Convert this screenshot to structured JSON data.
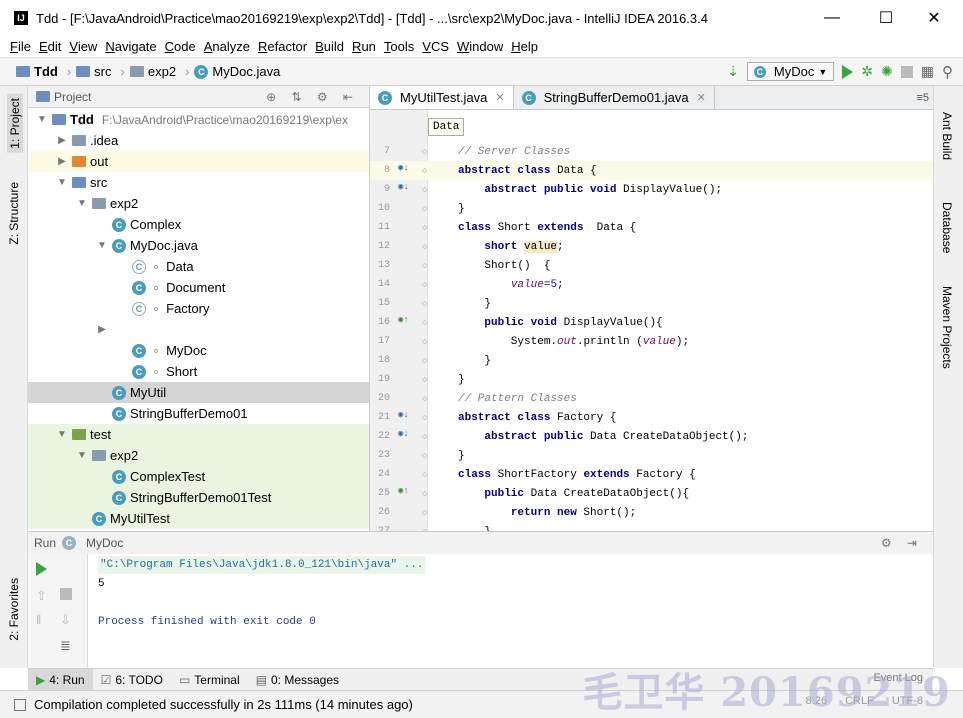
{
  "window": {
    "title": "Tdd - [F:\\JavaAndroid\\Practice\\mao20169219\\exp\\exp2\\Tdd] - [Tdd] - ...\\src\\exp2\\MyDoc.java - IntelliJ IDEA 2016.3.4",
    "app_icon": "IJ",
    "minimize": "—",
    "maximize": "☐",
    "close": "✕"
  },
  "menu": [
    "File",
    "Edit",
    "View",
    "Navigate",
    "Code",
    "Analyze",
    "Refactor",
    "Build",
    "Run",
    "Tools",
    "VCS",
    "Window",
    "Help"
  ],
  "breadcrumbs": [
    "Tdd",
    "src",
    "exp2",
    "MyDoc.java"
  ],
  "run_config": "MyDoc",
  "left_tabs": [
    "1: Project",
    "Z: Structure",
    "2: Favorites"
  ],
  "right_tabs": [
    "Ant Build",
    "Database",
    "Maven Projects"
  ],
  "project_panel": {
    "title": "Project",
    "tree": [
      {
        "label": "Tdd",
        "path": "F:\\JavaAndroid\\Practice\\mao20169219\\exp\\ex",
        "depth": 0,
        "arrow": "▼",
        "icon": "module",
        "state": ""
      },
      {
        "label": ".idea",
        "depth": 1,
        "arrow": "▶",
        "icon": "folder",
        "state": ""
      },
      {
        "label": "out",
        "depth": 1,
        "arrow": "▶",
        "icon": "folder-orange",
        "state": "yellow"
      },
      {
        "label": "src",
        "depth": 1,
        "arrow": "▼",
        "icon": "folder-blue",
        "state": ""
      },
      {
        "label": "exp2",
        "depth": 2,
        "arrow": "▼",
        "icon": "package",
        "state": ""
      },
      {
        "label": "Complex",
        "depth": 3,
        "arrow": "",
        "icon": "class",
        "state": ""
      },
      {
        "label": "MyDoc.java",
        "depth": 3,
        "arrow": "▼",
        "icon": "class",
        "state": ""
      },
      {
        "label": "Data",
        "depth": 4,
        "arrow": "",
        "icon": "class-abstract",
        "state": ""
      },
      {
        "label": "Document",
        "depth": 4,
        "arrow": "",
        "icon": "class",
        "state": ""
      },
      {
        "label": "Factory",
        "depth": 4,
        "arrow": "",
        "icon": "class-abstract",
        "state": ""
      },
      {
        "label": "",
        "depth": 3,
        "arrow": "▶",
        "icon": "",
        "state": ""
      },
      {
        "label": "MyDoc",
        "depth": 4,
        "arrow": "",
        "icon": "class-run",
        "state": ""
      },
      {
        "label": "Short",
        "depth": 4,
        "arrow": "",
        "icon": "class",
        "state": ""
      },
      {
        "label": "MyUtil",
        "depth": 3,
        "arrow": "",
        "icon": "class",
        "state": "sel"
      },
      {
        "label": "StringBufferDemo01",
        "depth": 3,
        "arrow": "",
        "icon": "class-run",
        "state": ""
      },
      {
        "label": "test",
        "depth": 1,
        "arrow": "▼",
        "icon": "folder-green",
        "state": "green"
      },
      {
        "label": "exp2",
        "depth": 2,
        "arrow": "▼",
        "icon": "package",
        "state": "green"
      },
      {
        "label": "ComplexTest",
        "depth": 3,
        "arrow": "",
        "icon": "class-run",
        "state": "green"
      },
      {
        "label": "StringBufferDemo01Test",
        "depth": 3,
        "arrow": "",
        "icon": "class-run",
        "state": "green"
      },
      {
        "label": "MyUtilTest",
        "depth": 2,
        "arrow": "",
        "icon": "class-run",
        "state": "green"
      }
    ]
  },
  "editor_tabs": [
    {
      "label": "MyUtilTest.java",
      "active": true
    },
    {
      "label": "StringBufferDemo01.java",
      "active": false
    }
  ],
  "editor_tab_count": "5",
  "crumb_tip": "Data",
  "code": [
    {
      "n": "7",
      "html": "<span class='cm'>// Server Classes</span>",
      "mark": ""
    },
    {
      "n": "8",
      "html": "<span class='kw'>abstract class</span> Data {",
      "mark": "impl",
      "cur": true
    },
    {
      "n": "9",
      "html": "    <span class='kw'>abstract public void</span> DisplayValue();",
      "mark": "impl"
    },
    {
      "n": "10",
      "html": "}",
      "mark": ""
    },
    {
      "n": "11",
      "html": "<span class='kw'>class</span> Short <span class='kw'>extends</span>  Data {",
      "mark": ""
    },
    {
      "n": "12",
      "html": "    <span class='kw'>short</span> <span class='vhl'>value</span>;",
      "mark": ""
    },
    {
      "n": "13",
      "html": "    Short()  {",
      "mark": ""
    },
    {
      "n": "14",
      "html": "        <span class='fld'>value</span>=<span class='num'>5</span>;",
      "mark": ""
    },
    {
      "n": "15",
      "html": "    }",
      "mark": ""
    },
    {
      "n": "16",
      "html": "    <span class='kw'>public void</span> DisplayValue(){",
      "mark": "over"
    },
    {
      "n": "17",
      "html": "        System.<span class='fld'>out</span>.println (<span class='fld'>value</span>);",
      "mark": ""
    },
    {
      "n": "18",
      "html": "    }",
      "mark": ""
    },
    {
      "n": "19",
      "html": "}",
      "mark": ""
    },
    {
      "n": "20",
      "html": "<span class='cm'>// Pattern Classes</span>",
      "mark": ""
    },
    {
      "n": "21",
      "html": "<span class='kw'>abstract class</span> Factory {",
      "mark": "impl"
    },
    {
      "n": "22",
      "html": "    <span class='kw'>abstract public</span> Data CreateDataObject();",
      "mark": "impl"
    },
    {
      "n": "23",
      "html": "}",
      "mark": ""
    },
    {
      "n": "24",
      "html": "<span class='kw'>class</span> ShortFactory <span class='kw'>extends</span> Factory {",
      "mark": ""
    },
    {
      "n": "25",
      "html": "    <span class='kw'>public</span> Data CreateDataObject(){",
      "mark": "over"
    },
    {
      "n": "26",
      "html": "        <span class='kw'>return new</span> Short();",
      "mark": ""
    },
    {
      "n": "27",
      "html": "    }",
      "mark": ""
    }
  ],
  "run_panel": {
    "title": "Run",
    "config": "MyDoc",
    "console": [
      {
        "text": "\"C:\\Program Files\\Java\\jdk1.8.0_121\\bin\\java\" ...",
        "color": "#1f6e9e",
        "bg": "#eaf5ea"
      },
      {
        "text": "5",
        "color": "#000",
        "bg": ""
      },
      {
        "text": "",
        "color": "#000",
        "bg": ""
      },
      {
        "text": "Process finished with exit code 0",
        "color": "#1f3f8e",
        "bg": ""
      }
    ]
  },
  "bottom_tabs": [
    {
      "label": "4: Run",
      "active": true
    },
    {
      "label": "6: TODO",
      "active": false
    },
    {
      "label": "Terminal",
      "active": false
    },
    {
      "label": "0: Messages",
      "active": false
    }
  ],
  "status": {
    "message": "Compilation completed successfully in 2s 111ms (14 minutes ago)",
    "position": "8:26",
    "line_sep": "CRLF",
    "encoding": "UTF-8"
  },
  "event_log": "Event Log",
  "watermark": "毛卫华 20169219"
}
